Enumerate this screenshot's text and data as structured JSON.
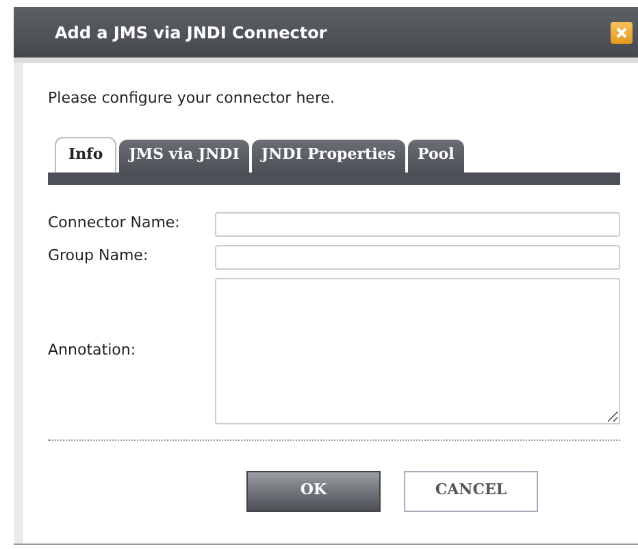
{
  "window": {
    "title": "Add a JMS via JNDI Connector"
  },
  "intro": "Please configure your connector here.",
  "tabs": [
    {
      "label": "Info",
      "selected": true
    },
    {
      "label": "JMS via JNDI",
      "selected": false
    },
    {
      "label": "JNDI Properties",
      "selected": false
    },
    {
      "label": "Pool",
      "selected": false
    }
  ],
  "fields": [
    {
      "label": "Connector Name:",
      "kind": "input"
    },
    {
      "label": "Group Name:",
      "kind": "input"
    },
    {
      "label": "Annotation:",
      "kind": "textarea"
    }
  ],
  "buttons": [
    {
      "label": "OK",
      "kind": "primary"
    },
    {
      "label": "CANCEL",
      "kind": "secondary"
    }
  ]
}
